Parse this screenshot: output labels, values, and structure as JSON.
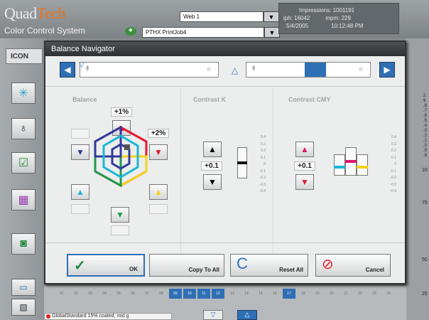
{
  "header": {
    "brand_a": "Quad",
    "brand_b": "Tech",
    "brand_sub": "Color Control System",
    "combo_top": "Web 1",
    "combo_job": "PTHX PrintJob4",
    "info": {
      "impressions": "Impressions: 1001191",
      "iph": "iph: 16042",
      "mpm": "mpm: 229",
      "date": "5/4/2005",
      "time": "10:12:48 PM"
    }
  },
  "left": {
    "tab": "ICON"
  },
  "right": {
    "numbers": [
      "2",
      "9",
      ".8",
      ".7",
      ".6",
      ".5",
      ".4",
      ".3",
      ".2",
      ".1",
      ".0",
      ".9",
      ".8"
    ],
    "labels": [
      "10",
      "75",
      "50",
      "25"
    ]
  },
  "dialog": {
    "title": "Balance Navigator",
    "balance": {
      "title": "Balance",
      "top_value": "+1%",
      "right_value": "+2%"
    },
    "contrast_k": {
      "title": "Contrast K",
      "value": "+0.1",
      "scale": [
        "0.4",
        "0.3",
        "0.2",
        "0.1",
        "0",
        "-0.1",
        "-0.2",
        "-0.3",
        "-0.4"
      ]
    },
    "contrast_cmy": {
      "title": "Contrast CMY",
      "value": "+0.1",
      "scale": [
        "0.4",
        "0.3",
        "0.2",
        "0.1",
        "0",
        "-0.1",
        "-0.2",
        "-0.3",
        "-0.4"
      ]
    },
    "buttons": {
      "ok": "OK",
      "copy": "Copy To All",
      "reset": "Reset All",
      "cancel": "Cancel"
    }
  },
  "zones": [
    "01",
    "02",
    "03",
    "04",
    "05",
    "06",
    "07",
    "08",
    "09",
    "10",
    "11",
    "12",
    "13",
    "14",
    "15",
    "16",
    "17",
    "18",
    "19",
    "20",
    "21",
    "22",
    "23",
    "24"
  ],
  "status": "GlobalStandard 15% coated, mid g",
  "colors": {
    "cyan": "#19b6d8",
    "magenta": "#e0156a",
    "yellow": "#f3d21a",
    "red": "#e21b2e",
    "green": "#1f9a4a",
    "blue": "#2f3a9a",
    "accent": "#2f6fb5"
  }
}
